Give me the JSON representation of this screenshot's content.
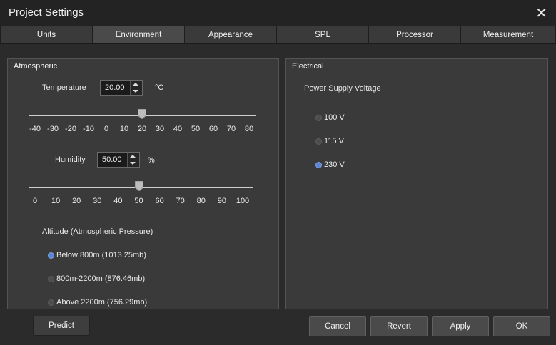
{
  "window": {
    "title": "Project Settings"
  },
  "tabs": [
    {
      "label": "Units"
    },
    {
      "label": "Environment"
    },
    {
      "label": "Appearance"
    },
    {
      "label": "SPL"
    },
    {
      "label": "Processor"
    },
    {
      "label": "Measurement"
    }
  ],
  "active_tab": "Environment",
  "atmospheric": {
    "title": "Atmospheric",
    "temperature": {
      "label": "Temperature",
      "value": "20.00",
      "unit": "°C",
      "slider_value": 20,
      "slider_min": -40,
      "slider_max": 80,
      "ticks": [
        "-40",
        "-30",
        "-20",
        "-10",
        "0",
        "10",
        "20",
        "30",
        "40",
        "50",
        "60",
        "70",
        "80"
      ]
    },
    "humidity": {
      "label": "Humidity",
      "value": "50.00",
      "unit": "%",
      "slider_value": 50,
      "slider_min": 0,
      "slider_max": 100,
      "ticks": [
        "0",
        "10",
        "20",
        "30",
        "40",
        "50",
        "60",
        "70",
        "80",
        "90",
        "100"
      ]
    },
    "altitude": {
      "label": "Altitude (Atmospheric Pressure)",
      "options": [
        {
          "label": "Below 800m (1013.25mb)",
          "selected": true
        },
        {
          "label": "800m-2200m (876.46mb)",
          "selected": false
        },
        {
          "label": "Above 2200m (756.29mb)",
          "selected": false
        }
      ]
    }
  },
  "electrical": {
    "title": "Electrical",
    "voltage_label": "Power Supply Voltage",
    "options": [
      {
        "label": "100 V",
        "selected": false
      },
      {
        "label": "115 V",
        "selected": false
      },
      {
        "label": "230 V",
        "selected": true
      }
    ]
  },
  "buttons": {
    "predict": "Predict",
    "cancel": "Cancel",
    "revert": "Revert",
    "apply": "Apply",
    "ok": "OK"
  },
  "colors": {
    "radio_selected": "#5b86d6",
    "background": "#2b2b2b",
    "panel": "#3a3a3a"
  }
}
